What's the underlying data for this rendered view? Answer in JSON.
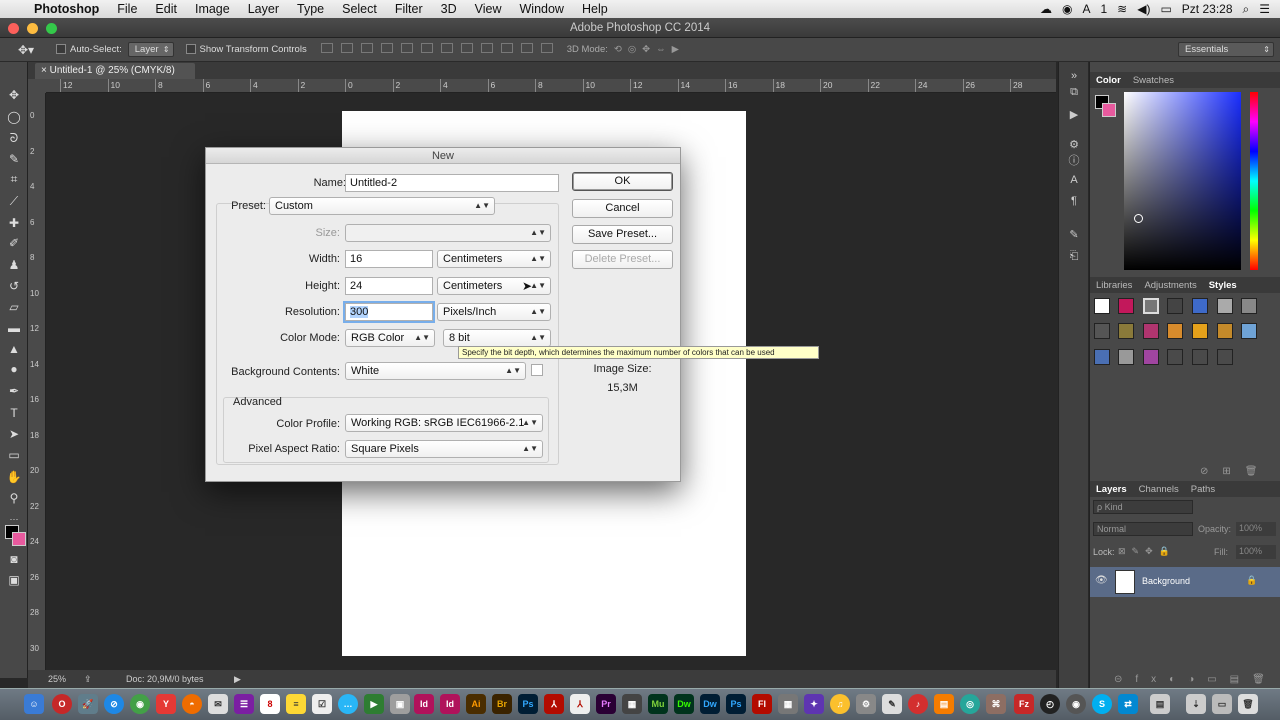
{
  "menubar": {
    "app": "Photoshop",
    "items": [
      "File",
      "Edit",
      "Image",
      "Layer",
      "Type",
      "Select",
      "Filter",
      "3D",
      "View",
      "Window",
      "Help"
    ],
    "status": {
      "user_a": "A",
      "user_1": "1",
      "clock": "Pzt 23:28"
    }
  },
  "window": {
    "title": "Adobe Photoshop CC 2014"
  },
  "options": {
    "auto_select_label": "Auto-Select:",
    "auto_select_value": "Layer",
    "transform_label": "Show Transform Controls",
    "mode_3d": "3D Mode:",
    "workspace": "Essentials"
  },
  "document": {
    "tab": "Untitled-1 @ 25% (CMYK/8)",
    "zoom": "25%",
    "doc_size": "Doc: 20,9M/0 bytes"
  },
  "rulers": {
    "h": [
      "12",
      "10",
      "8",
      "6",
      "4",
      "2",
      "0",
      "2",
      "4",
      "6",
      "8",
      "10",
      "12",
      "14",
      "16",
      "18",
      "20",
      "22",
      "24",
      "26",
      "28"
    ],
    "v": [
      "0",
      "2",
      "4",
      "6",
      "8",
      "1 0",
      "1 2",
      "1 4",
      "1 6",
      "1 8",
      "2 0",
      "2 2",
      "2 4",
      "2 6",
      "2 8",
      "3 0"
    ]
  },
  "panels": {
    "color_tabs": [
      "Color",
      "Swatches"
    ],
    "lib_tabs": [
      "Libraries",
      "Adjustments",
      "Styles"
    ],
    "layer_tabs": [
      "Layers",
      "Channels",
      "Paths"
    ],
    "kind": "Kind",
    "blend": "Normal",
    "opacity_label": "Opacity:",
    "opacity_value": "100%",
    "lock_label": "Lock:",
    "fill_label": "Fill:",
    "fill_value": "100%",
    "layer_name": "Background"
  },
  "dialog": {
    "title": "New",
    "name_label": "Name:",
    "name_value": "Untitled-2",
    "preset_label": "Preset:",
    "preset_value": "Custom",
    "size_label": "Size:",
    "width_label": "Width:",
    "width_value": "16",
    "width_unit": "Centimeters",
    "height_label": "Height:",
    "height_value": "24",
    "height_unit": "Centimeters",
    "res_label": "Resolution:",
    "res_value": "300",
    "res_unit": "Pixels/Inch",
    "mode_label": "Color Mode:",
    "mode_value": "RGB Color",
    "bit_value": "8 bit",
    "bg_label": "Background Contents:",
    "bg_value": "White",
    "advanced_label": "Advanced",
    "profile_label": "Color Profile:",
    "profile_value": "Working RGB:  sRGB IEC61966-2.1",
    "par_label": "Pixel Aspect Ratio:",
    "par_value": "Square Pixels",
    "ok": "OK",
    "cancel": "Cancel",
    "save_preset": "Save Preset...",
    "delete_preset": "Delete Preset...",
    "image_size_label": "Image Size:",
    "image_size_value": "15,3M",
    "tooltip": "Specify the bit depth, which determines the maximum number of colors that can be used"
  },
  "dock_apps": [
    "Id",
    "Id",
    "Ai",
    "Br",
    "Ps",
    "Pr",
    "Mu",
    "Dw",
    "Ps",
    "Fl"
  ],
  "colors": {
    "accent": "#5a6b88",
    "tooltip": "#ffffc8",
    "foreground_swatch": "#e85a9e"
  }
}
